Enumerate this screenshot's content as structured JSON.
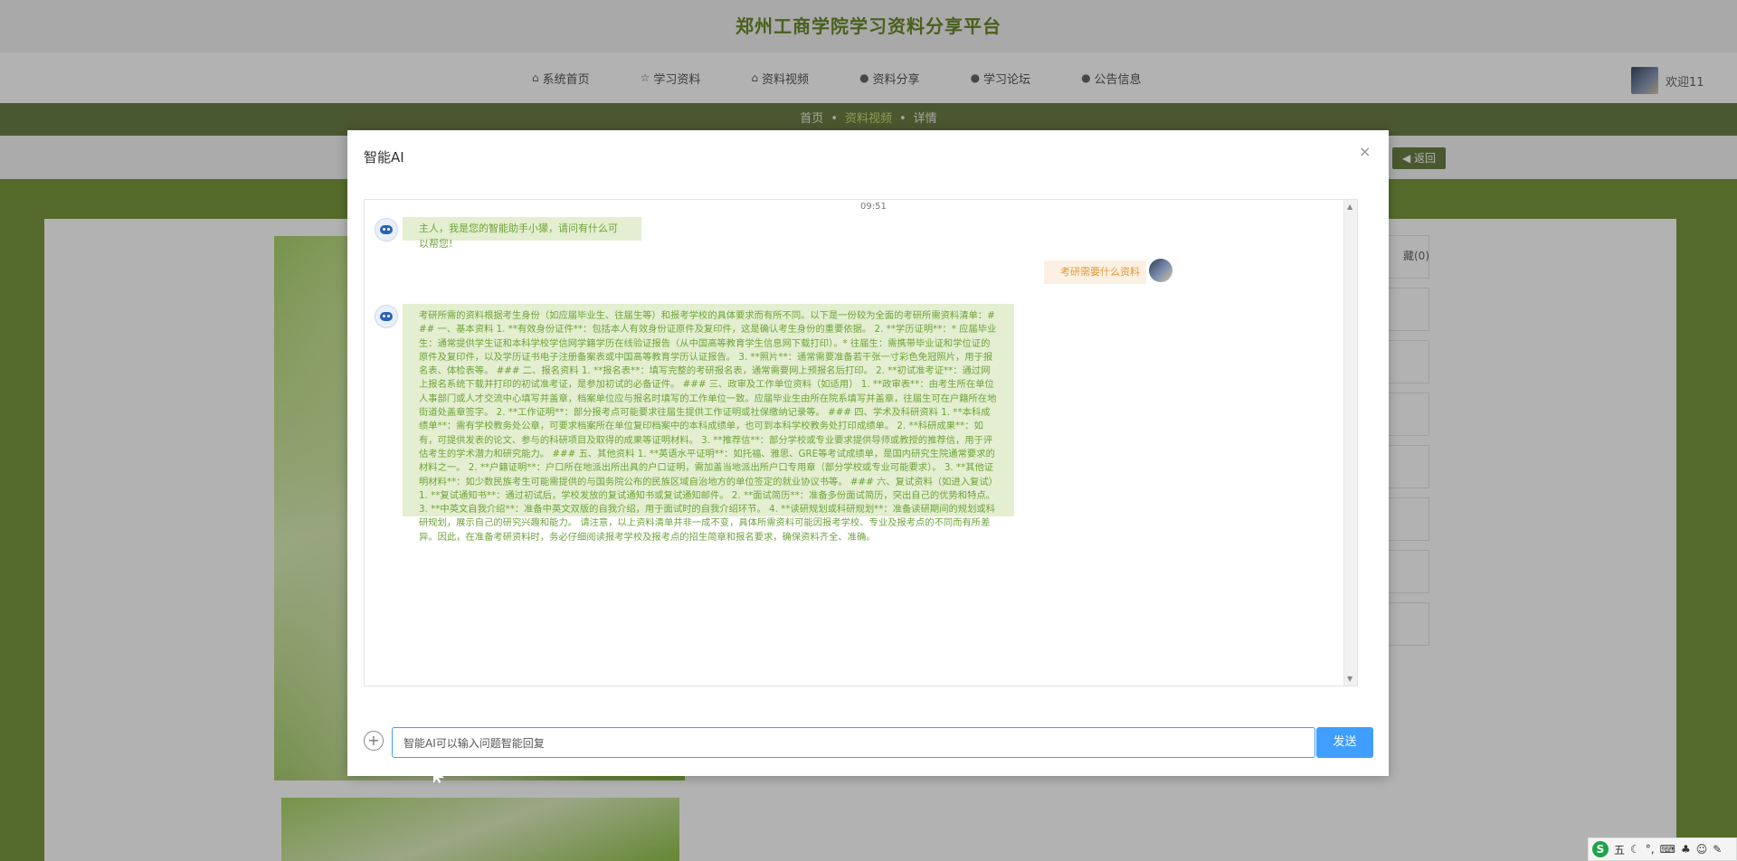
{
  "site": {
    "title": "郑州工商学院学习资料分享平台"
  },
  "nav": {
    "items": [
      {
        "icon": "home-icon",
        "label": "系统首页"
      },
      {
        "icon": "star-icon",
        "label": "学习资料"
      },
      {
        "icon": "home-icon",
        "label": "资料视频"
      },
      {
        "icon": "info-icon",
        "label": "资料分享"
      },
      {
        "icon": "info-icon",
        "label": "学习论坛"
      },
      {
        "icon": "info-icon",
        "label": "公告信息"
      }
    ],
    "welcome": "欢迎11"
  },
  "breadcrumb": {
    "home": "首页",
    "current": "资料视频",
    "detail": "详情"
  },
  "back_button": "◀ 返回",
  "side_count": "藏(0)",
  "modal": {
    "title": "智能AI",
    "close": "×",
    "time": "09:51",
    "messages": {
      "greeting": "主人，我是您的智能助手小獴，请问有什么可以帮您!",
      "user_question": "考研需要什么资料",
      "answer": "考研所需的资料根据考生身份（如应届毕业生、往届生等）和报考学校的具体要求而有所不同。以下是一份较为全面的考研所需资料清单：### 一、基本资料 1. **有效身份证件**：包括本人有效身份证原件及复印件，这是确认考生身份的重要依据。 2. **学历证明**：* 应届毕业生：通常提供学生证和本科学校学信网学籍学历在线验证报告（从中国高等教育学生信息网下载打印）。* 往届生：需携带毕业证和学位证的原件及复印件，以及学历证书电子注册备案表或中国高等教育学历认证报告。 3. **照片**：通常需要准备若干张一寸彩色免冠照片，用于报名表、体检表等。 ### 二、报名资料 1. **报名表**：填写完整的考研报名表，通常需要网上预报名后打印。 2. **初试准考证**：通过网上报名系统下载并打印的初试准考证，是参加初试的必备证件。 ### 三、政审及工作单位资料（如适用） 1. **政审表**：由考生所在单位人事部门或人才交流中心填写并盖章，档案单位应与报名时填写的工作单位一致。应届毕业生由所在院系填写并盖章，往届生可在户籍所在地街道处盖章签字。 2. **工作证明**：部分报考点可能要求往届生提供工作证明或社保缴纳记录等。 ### 四、学术及科研资料 1. **本科成绩单**：需有学校教务处公章，可要求档案所在单位复印档案中的本科成绩单，也可到本科学校教务处打印成绩单。 2. **科研成果**：如有，可提供发表的论文、参与的科研项目及取得的成果等证明材料。 3. **推荐信**：部分学校或专业要求提供导师或教授的推荐信，用于评估考生的学术潜力和研究能力。 ### 五、其他资料 1. **英语水平证明**：如托福、雅思、GRE等考试成绩单，是国内研究生院通常要求的材料之一。 2. **户籍证明**：户口所在地派出所出具的户口证明，需加盖当地派出所户口专用章（部分学校或专业可能要求）。 3. **其他证明材料**：如少数民族考生可能需提供的与国务院公布的民族区域自治地方的单位签定的就业协议书等。 ### 六、复试资料（如进入复试） 1. **复试通知书**：通过初试后，学校发放的复试通知书或复试通知邮件。 2. **面试简历**：准备多份面试简历，突出自己的优势和特点。 3. **中英文自我介绍**：准备中英文双版的自我介绍，用于面试时的自我介绍环节。 4. **读研规划或科研规划**：准备读研期间的规划或科研规划，展示自己的研究兴趣和能力。 请注意，以上资料清单并非一成不变，具体所需资料可能因报考学校、专业及报考点的不同而有所差异。因此，在准备考研资料时，务必仔细阅读报考学校及报考点的招生简章和报名要求，确保资料齐全、准确。"
    },
    "input_placeholder": "智能AI可以输入问题智能回复",
    "send_label": "发送"
  },
  "ime": {
    "logo": "S",
    "mode": "五"
  }
}
